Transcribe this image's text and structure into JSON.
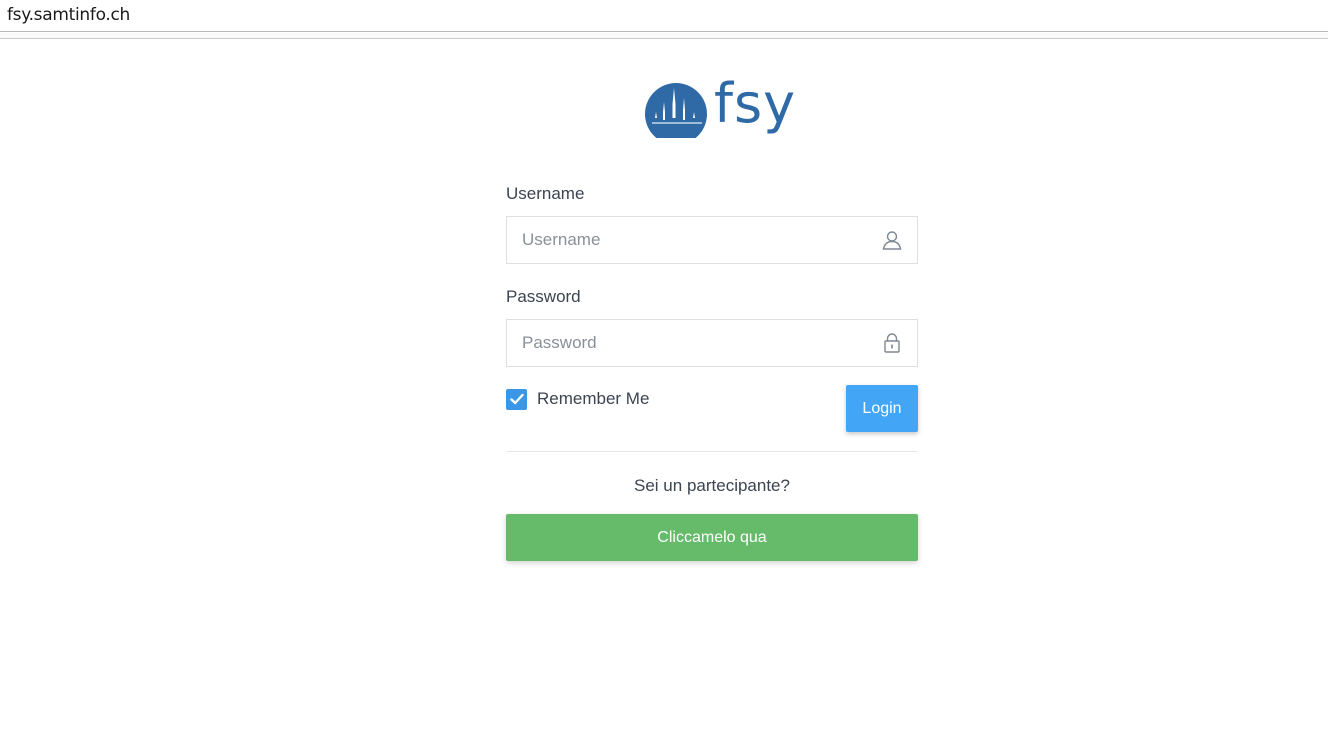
{
  "browser": {
    "url": "fsy.samtinfo.ch"
  },
  "logo": {
    "text": "fsy"
  },
  "form": {
    "username_label": "Username",
    "username_placeholder": "Username",
    "password_label": "Password",
    "password_placeholder": "Password",
    "remember_label": "Remember Me",
    "remember_checked": true,
    "login_label": "Login",
    "participant_question": "Sei un partecipante?",
    "participant_button": "Cliccamelo qua"
  },
  "icons": {
    "username": "user-icon",
    "password": "lock-icon",
    "checkbox": "check-icon"
  },
  "colors": {
    "brand": "#2f6aa7",
    "login_button": "#42a5f5",
    "participant_button": "#66bb6a",
    "checkbox": "#3a97e6"
  }
}
